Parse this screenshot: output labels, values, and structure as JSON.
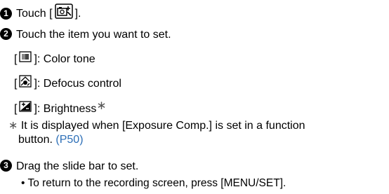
{
  "step1": {
    "num": "1",
    "text_before": "Touch [",
    "text_after": "]."
  },
  "step2": {
    "num": "2",
    "text": "Touch the item you want to set."
  },
  "options": [
    {
      "icon": "color-tone-icon",
      "prefix": "[",
      "suffix": "]: Color tone"
    },
    {
      "icon": "defocus-control-icon",
      "prefix": "[",
      "suffix": "]: Defocus control"
    },
    {
      "icon": "brightness-icon",
      "prefix": "[",
      "suffix": "]: Brightness",
      "mark": "∗"
    }
  ],
  "note": {
    "mark": "∗",
    "text1": "It is displayed when [Exposure Comp.] is set in a function",
    "text2": "button.",
    "link": "(P50)"
  },
  "step3": {
    "num": "3",
    "text": "Drag the slide bar to set."
  },
  "bullet": {
    "mark": "•",
    "text": "To return to the recording screen, press [MENU/SET]."
  },
  "colors": {
    "link": "#2d6fb7"
  }
}
